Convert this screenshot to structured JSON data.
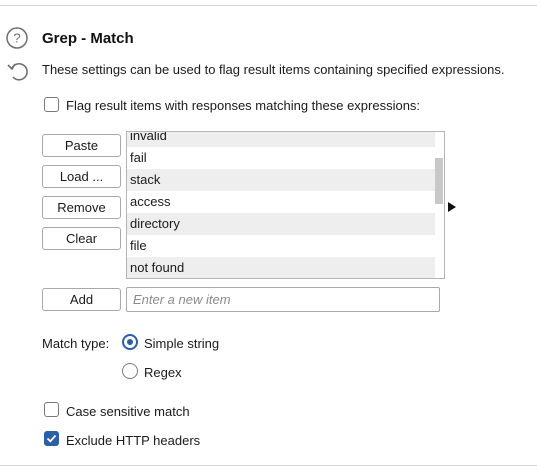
{
  "section": {
    "title": "Grep - Match",
    "description": "These settings can be used to flag result items containing specified expressions.",
    "help_icon": "help-circle-icon",
    "reset_icon": "reset-arrow-icon"
  },
  "flag_option": {
    "label": "Flag result items with responses matching these expressions:",
    "checked": false
  },
  "list_buttons": {
    "paste": "Paste",
    "load": "Load ...",
    "remove": "Remove",
    "clear": "Clear",
    "add": "Add"
  },
  "expressions": [
    "invalid",
    "fail",
    "stack",
    "access",
    "directory",
    "file",
    "not found"
  ],
  "new_item": {
    "placeholder": "Enter a new item",
    "value": ""
  },
  "match_type": {
    "label": "Match type:",
    "options": [
      "Simple string",
      "Regex"
    ],
    "selected": "Simple string"
  },
  "case_sensitive": {
    "label": "Case sensitive match",
    "checked": false
  },
  "exclude_headers": {
    "label": "Exclude HTTP headers",
    "checked": true
  },
  "colors": {
    "accent": "#2b5fa6",
    "row_alt": "#eeeeee",
    "border": "#a9a9a9"
  }
}
